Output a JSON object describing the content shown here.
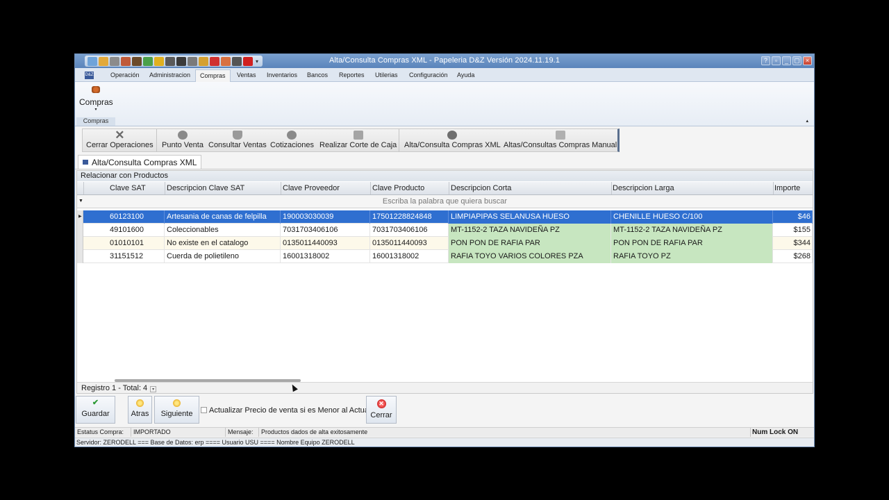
{
  "window": {
    "title": "Alta/Consulta Compras XML - Papeleria D&Z  Versión 2024.11.19.1",
    "logo_text": "D&Z"
  },
  "menu": {
    "tabs": [
      "Operación",
      "Administracion",
      "Compras",
      "Ventas",
      "Inventarios",
      "Bancos",
      "Reportes",
      "Utilerias",
      "Configuración",
      "Ayuda"
    ],
    "active": "Compras"
  },
  "ribbon": {
    "button_label": "Compras",
    "group_label": "Compras"
  },
  "toolbar": {
    "items": [
      "Cerrar Operaciones",
      "Punto Venta",
      "Consultar Ventas",
      "Cotizaciones",
      "Realizar Corte de Caja",
      "Alta/Consulta Compras XML",
      "Altas/Consultas Compras Manual"
    ]
  },
  "doc_tab": {
    "label": "Alta/Consulta Compras XML"
  },
  "panel": {
    "title": "Relacionar con Productos",
    "search_placeholder": "Escriba la palabra que quiera buscar",
    "columns": [
      "Clave SAT",
      "Descripcion Clave SAT",
      "Clave Proveedor",
      "Clave Producto",
      "Descripcion Corta",
      "Descripcion Larga",
      "Importe"
    ],
    "rows": [
      {
        "clave_sat": "60123100",
        "desc_sat": "Artesania de canas de felpilla",
        "clave_prov": "190003030039",
        "clave_prod": "17501228824848",
        "desc_corta": "LIMPIAPIPAS SELANUSA HUESO",
        "desc_larga": "CHENILLE HUESO C/100",
        "importe": "$46"
      },
      {
        "clave_sat": "49101600",
        "desc_sat": "Coleccionables",
        "clave_prov": "7031703406106",
        "clave_prod": "7031703406106",
        "desc_corta": "MT-1152-2 TAZA NAVIDEÑA PZ",
        "desc_larga": "MT-1152-2 TAZA NAVIDEÑA PZ",
        "importe": "$155"
      },
      {
        "clave_sat": "01010101",
        "desc_sat": "No existe en el catalogo",
        "clave_prov": "0135011440093",
        "clave_prod": "0135011440093",
        "desc_corta": "PON PON DE RAFIA PAR",
        "desc_larga": "PON PON DE RAFIA PAR",
        "importe": "$344"
      },
      {
        "clave_sat": "31151512",
        "desc_sat": "Cuerda de polietileno",
        "clave_prov": "16001318002",
        "clave_prod": "16001318002",
        "desc_corta": "RAFIA TOYO VARIOS COLORES PZA",
        "desc_larga": "RAFIA TOYO PZ",
        "importe": "$268"
      }
    ],
    "footer": "Registro 1 - Total: 4"
  },
  "actions": {
    "guardar": "Guardar",
    "atras": "Atras",
    "siguiente": "Siguiente",
    "checkbox_label": "Actualizar Precio de venta si es Menor al Actual",
    "cerrar": "Cerrar"
  },
  "status": {
    "estatus_label": "Estatus Compra:",
    "estatus_value": "IMPORTADO",
    "mensaje_label": "Mensaje:",
    "mensaje_value": "Productos dados de alta exitosamente",
    "numlock": "Num Lock ON",
    "server_line": "Servidor: ZERODELL === Base de Datos: erp ==== Usuario USU ==== Nombre Equipo ZERODELL"
  },
  "colors": {
    "selected_row": "#2f6fd0",
    "matched_cell": "#c7e6c0",
    "title_bar": "#6a90c5"
  }
}
